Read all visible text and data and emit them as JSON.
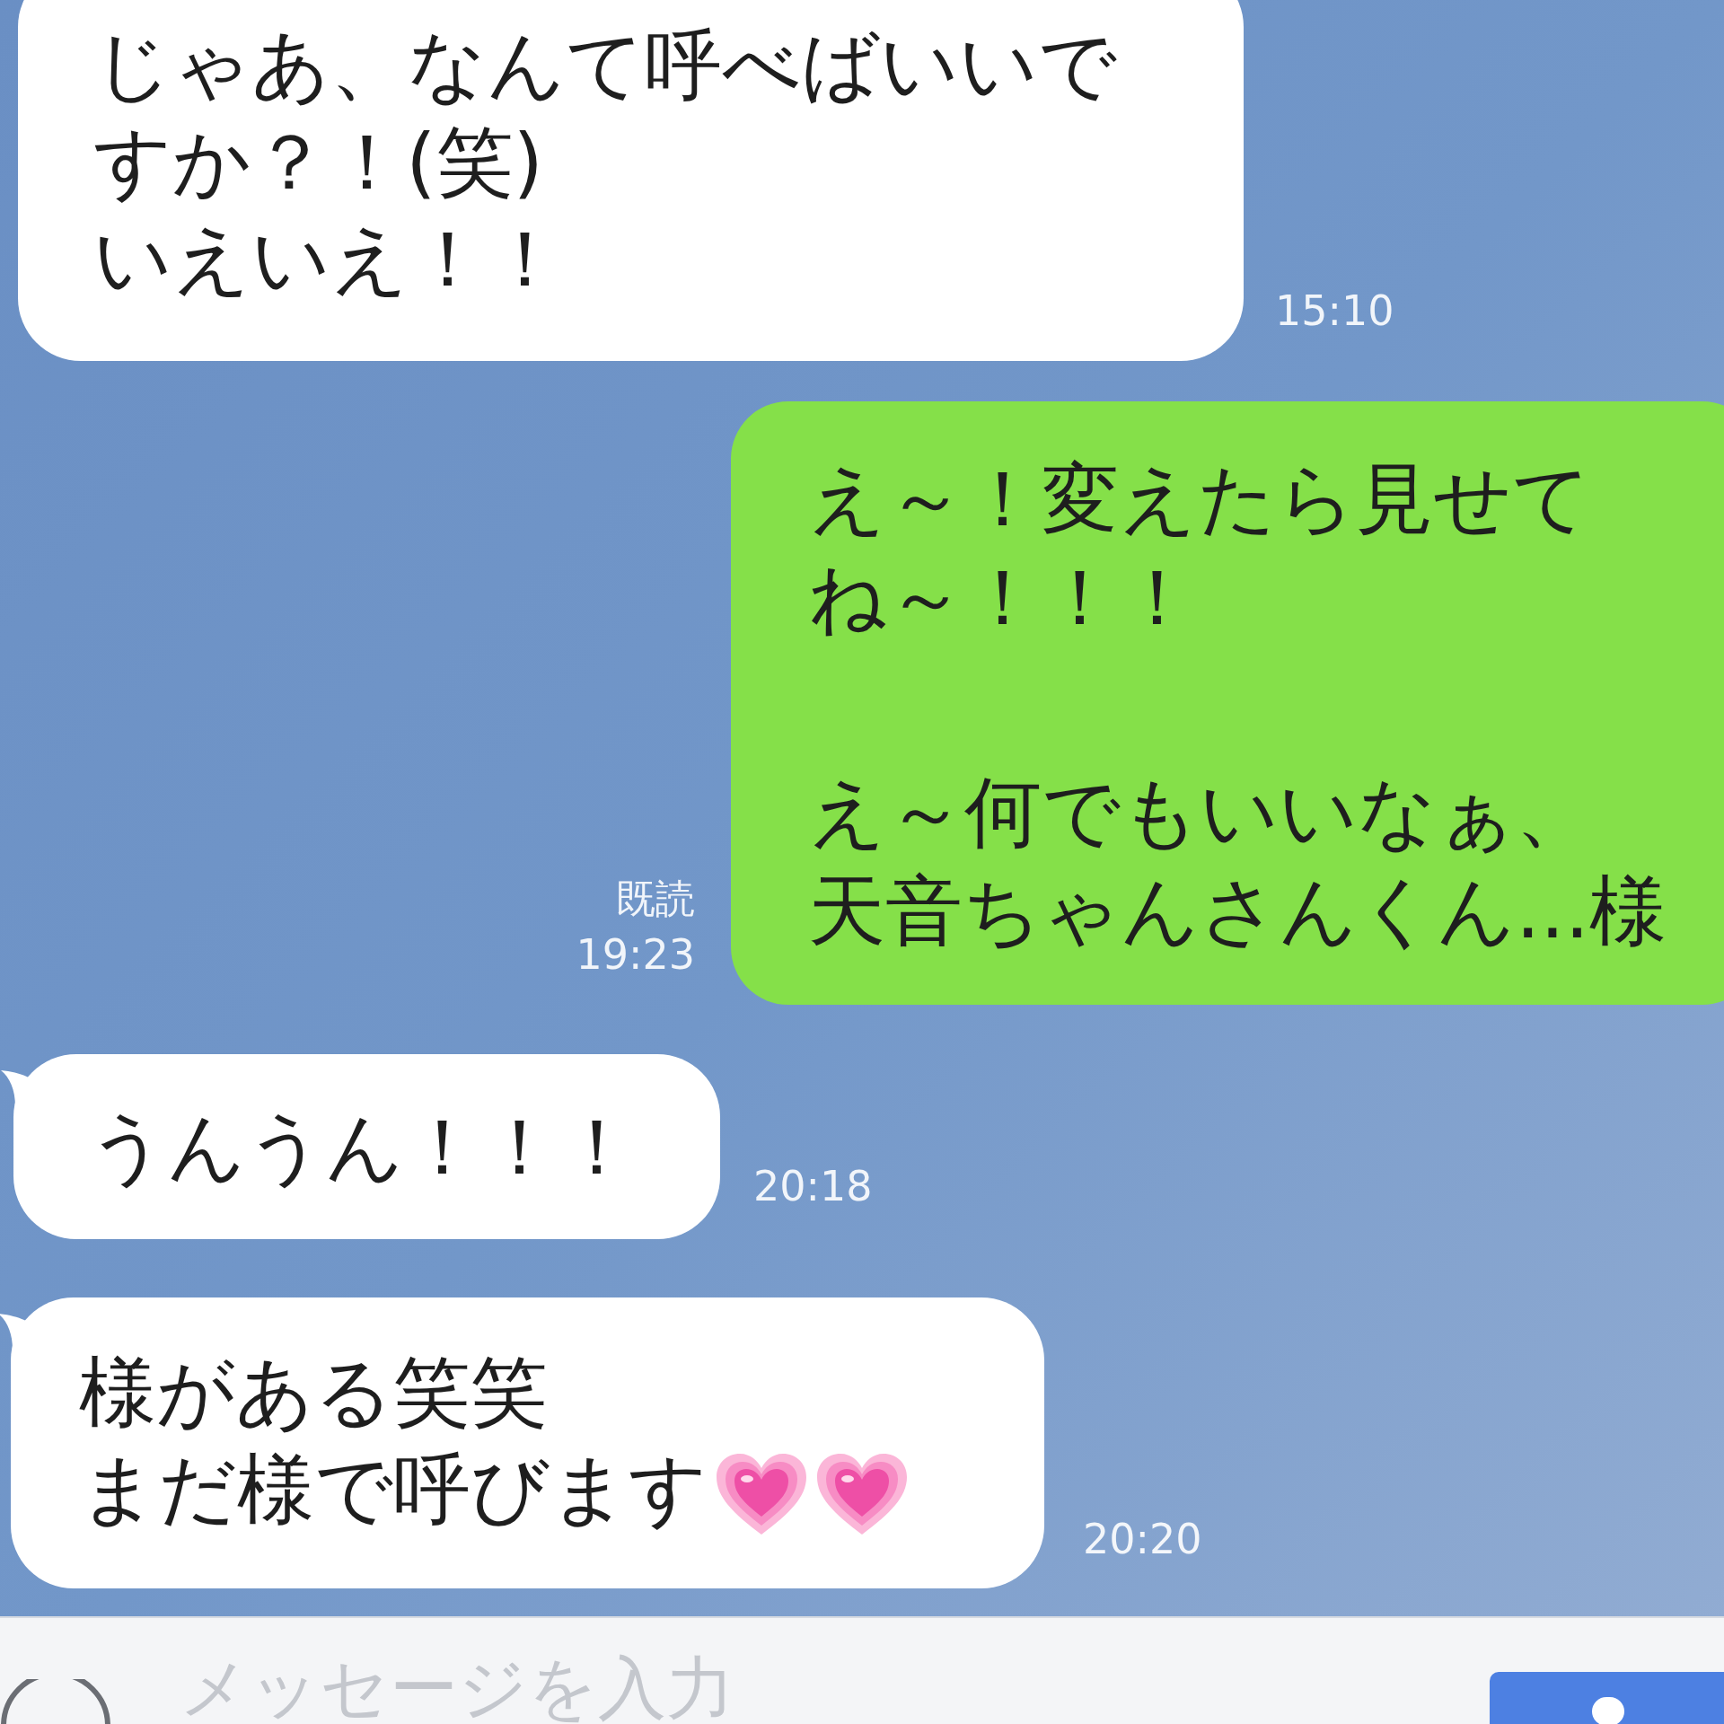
{
  "messages": [
    {
      "kind": "incoming",
      "paragraphs": [
        [
          "じゃあ、なんて呼べばいいで",
          "すか？！(笑)",
          "いえいえ！！"
        ]
      ],
      "time": "15:10",
      "tail": false
    },
    {
      "kind": "outgoing",
      "paragraphs": [
        [
          "え～！変えたら見せて",
          "ね～！！！"
        ],
        [
          "え～何でもいいなぁ、",
          "天音ちゃんさんくん...様"
        ]
      ],
      "read": "既読",
      "time": "19:23"
    },
    {
      "kind": "incoming",
      "paragraphs": [
        [
          "うんうん！！！"
        ]
      ],
      "time": "20:18",
      "tail": true
    },
    {
      "kind": "incoming",
      "paragraphs": [
        [
          "様がある笑笑",
          "まだ様で呼びます"
        ]
      ],
      "icons": [
        {
          "kind": "heart"
        },
        {
          "kind": "heart"
        }
      ],
      "time": "20:20",
      "tail": true
    }
  ],
  "input": {
    "placeholder": "メッセージを入力"
  }
}
